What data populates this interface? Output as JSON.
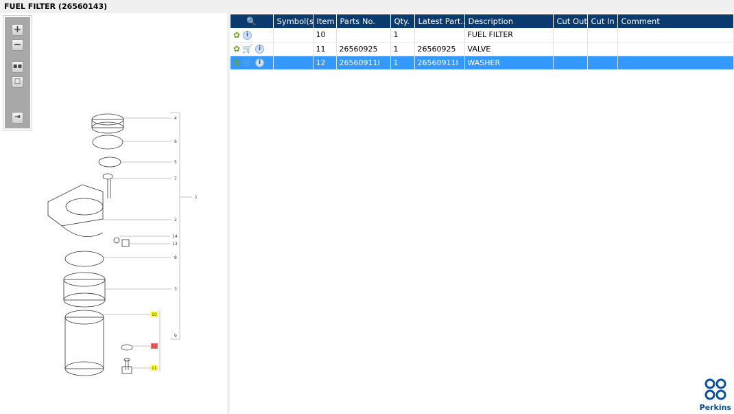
{
  "title": "FUEL FILTER (26560143)",
  "toolbar": {
    "zoom_in": "zoom-in",
    "zoom_out": "zoom-out",
    "fit": "fit",
    "actual": "actual-size",
    "export": "export"
  },
  "table": {
    "columns": [
      "",
      "Symbol(s)",
      "Item",
      "Parts No.",
      "Qty.",
      "Latest Part...",
      "Description",
      "Cut Out",
      "Cut In",
      "Comment"
    ],
    "rows": [
      {
        "item": "10",
        "parts_no": "",
        "qty": "1",
        "latest": "",
        "description": "FUEL FILTER",
        "cart": false,
        "selected": false
      },
      {
        "item": "11",
        "parts_no": "26560925",
        "qty": "1",
        "latest": "26560925",
        "description": "VALVE",
        "cart": true,
        "selected": false
      },
      {
        "item": "12",
        "parts_no": "26560911I",
        "qty": "1",
        "latest": "26560911I",
        "description": "WASHER",
        "cart": true,
        "selected": true
      }
    ]
  },
  "diagram": {
    "callouts": [
      "4",
      "6",
      "5",
      "7",
      "1",
      "2",
      "14",
      "13",
      "8",
      "3",
      "10",
      "12",
      "11",
      "9"
    ]
  },
  "logo": {
    "text": "Perkins"
  },
  "colors": {
    "header": "#0b3a6e",
    "selected": "#3399ff",
    "highlight_yellow": "#ffff33",
    "highlight_red": "#ff6666"
  }
}
